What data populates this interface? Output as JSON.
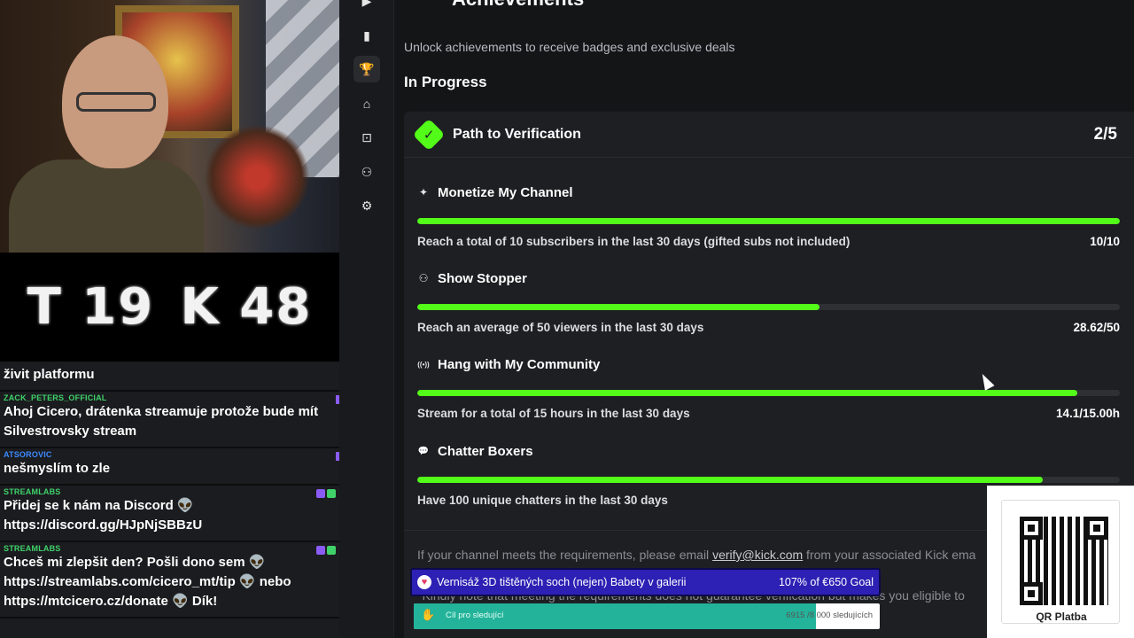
{
  "scoreboard": {
    "left": "T 19",
    "right": "K 48"
  },
  "chat": [
    {
      "user": "",
      "text": "živit platformu",
      "user_color": "green",
      "badges": []
    },
    {
      "user": "ZACK_PETERS_OFFICIAL",
      "text": "Ahoj Cicero, drátenka streamuje protože bude mít Silvestrovsky stream",
      "user_color": "green",
      "badges": []
    },
    {
      "user": "ATSOROVIC",
      "text": "nešmyslím to zle",
      "user_color": "blue",
      "badges": []
    },
    {
      "user": "STREAMLABS",
      "text": "Přidej se k nám na Discord 👽 https://discord.gg/HJpNjSBBzU",
      "user_color": "green",
      "badges": [
        "p",
        "g"
      ]
    },
    {
      "user": "STREAMLABS",
      "text": "Chceš mi zlepšit den? Pošli dono sem 👽 https://streamlabs.com/cicero_mt/tip 👽 nebo https://mtcicero.cz/donate 👽 Dík!",
      "user_color": "green",
      "badges": [
        "p",
        "g"
      ]
    }
  ],
  "sidebar": {
    "items": [
      {
        "icon": "play-icon",
        "glyph": "▶",
        "active": false
      },
      {
        "icon": "analytics-icon",
        "glyph": "▮",
        "active": false
      },
      {
        "icon": "trophy-icon",
        "glyph": "🏆",
        "active": true
      },
      {
        "icon": "cake-icon",
        "glyph": "⌂",
        "active": false
      },
      {
        "icon": "screen-capture-icon",
        "glyph": "⊡",
        "active": false
      },
      {
        "icon": "users-icon",
        "glyph": "⚇",
        "active": false
      },
      {
        "icon": "gear-icon",
        "glyph": "⚙",
        "active": false
      }
    ]
  },
  "page": {
    "title": "Achievements",
    "subtitle": "Unlock achievements to receive badges and exclusive deals",
    "section": "In Progress"
  },
  "card": {
    "title": "Path to Verification",
    "count": "2/5",
    "achievements": [
      {
        "icon": "sparkle-icon",
        "glyph": "✦",
        "title": "Monetize My Channel",
        "desc": "Reach a total of 10 subscribers in the last 30 days (gifted subs not included)",
        "value": "10/10",
        "progress": 1.0
      },
      {
        "icon": "viewers-icon",
        "glyph": "⚇",
        "title": "Show Stopper",
        "desc": "Reach an average of 50 viewers in the last 30 days",
        "value": "28.62/50",
        "progress": 0.5724
      },
      {
        "icon": "broadcast-icon",
        "glyph": "((•))",
        "title": "Hang with My Community",
        "desc": "Stream for a total of 15 hours in the last 30 days",
        "value": "14.1/15.00h",
        "progress": 0.94
      },
      {
        "icon": "chat-bubble-icon",
        "glyph": "💬",
        "title": "Chatter Boxers",
        "desc": "Have 100 unique chatters in the last 30 days",
        "value": "",
        "progress": 0.89
      }
    ],
    "footer_line1_pre": "If your channel meets the requirements, please email ",
    "footer_email": "verify@kick.com",
    "footer_line1_post": " from your associated Kick ema",
    "footer_line2": "*Kindly note that meeting the requirements does not guarantee verification but makes you eligible to"
  },
  "overlay": {
    "alert_text": "Vernisáž 3D tištěných soch (nejen) Babety v galerii",
    "goal_text": "107% of €650 Goal",
    "follow_label": "Cíl pro sledující",
    "follow_count": "6915 /8 000 sledujících",
    "follow_progress": 0.864,
    "qr_label": "QR Platba"
  },
  "colors": {
    "accent": "#53fc18",
    "background": "#141517",
    "card": "#1e1f23"
  }
}
